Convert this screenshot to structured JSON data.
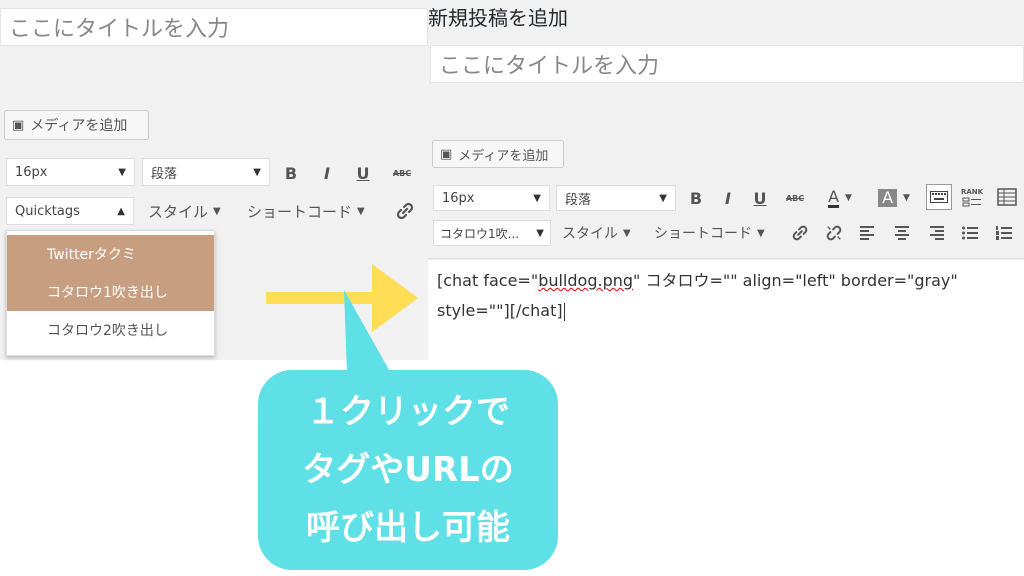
{
  "colors": {
    "highlight": "#c79f80",
    "arrow": "#ffdd55",
    "bubble": "#5fdfe6"
  },
  "left": {
    "title_placeholder": "ここにタイトルを入力",
    "media_button": "メディアを追加",
    "font_size": "16px",
    "paragraph": "段落",
    "bold": "B",
    "italic": "I",
    "underline": "U",
    "strike": "ABC",
    "quicktags": "Quicktags",
    "style_menu": "スタイル",
    "shortcode_menu": "ショートコード",
    "dropdown_items": [
      "Twitterタクミ",
      "コタロウ1吹き出し",
      "コタロウ2吹き出し"
    ]
  },
  "right": {
    "page_title": "新規投稿を追加",
    "title_placeholder": "ここにタイトルを入力",
    "media_button": "メディアを追加",
    "font_size": "16px",
    "paragraph": "段落",
    "bold": "B",
    "italic": "I",
    "underline": "U",
    "strike": "ABC",
    "text_color": "A",
    "bg_color": "A",
    "rank": "RANK",
    "quicktag_selected": "コタロウ1吹...",
    "style_menu": "スタイル",
    "shortcode_menu": "ショートコード",
    "editor_line1_pre": "[chat face=\"",
    "editor_line1_word": "bulldog.png",
    "editor_line1_post": "\" コタロウ=\"\" align=\"left\" border=\"gray\"",
    "editor_line2": "style=\"\"][/chat]"
  },
  "annotation": {
    "bubble_lines": [
      "１クリックで",
      "タグやURLの",
      "呼び出し可能"
    ]
  }
}
